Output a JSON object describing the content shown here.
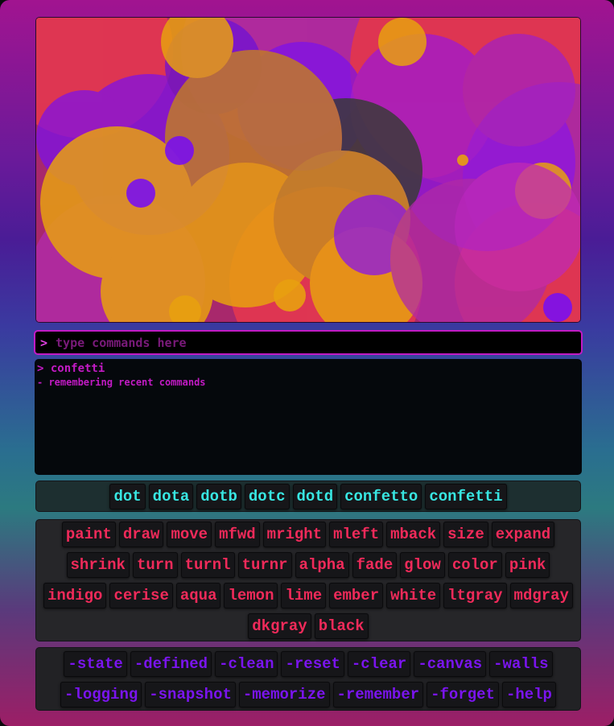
{
  "command_input": {
    "prompt": ">",
    "placeholder": "type commands here",
    "value": ""
  },
  "log": [
    {
      "text": "> confetti"
    },
    {
      "text": "- remembering recent commands"
    }
  ],
  "dot_commands": [
    "dot",
    "dota",
    "dotb",
    "dotc",
    "dotd",
    "confetto",
    "confetti"
  ],
  "draw_commands": [
    "paint",
    "draw",
    "move",
    "mfwd",
    "mright",
    "mleft",
    "mback",
    "size",
    "expand",
    "shrink",
    "turn",
    "turnl",
    "turnr",
    "alpha",
    "fade",
    "glow",
    "color",
    "pink",
    "indigo",
    "cerise",
    "aqua",
    "lemon",
    "lime",
    "ember",
    "white",
    "ltgray",
    "mdgray",
    "dkgray",
    "black"
  ],
  "system_commands": [
    "-state",
    "-defined",
    "-clean",
    "-reset",
    "-clear",
    "-canvas",
    "-walls",
    "-logging",
    "-snapshot",
    "-memorize",
    "-remember",
    "-forget",
    "-help"
  ],
  "colors": {
    "cerise": "#e8384e",
    "indigo": "#7a10ee",
    "lemon": "#e8a010",
    "pink": "#b02aa6",
    "dkgray": "#3a3a3a",
    "dot_button_text": "#38e6e2",
    "draw_button_text": "#f02a5a",
    "system_button_text": "#7a14ee"
  }
}
